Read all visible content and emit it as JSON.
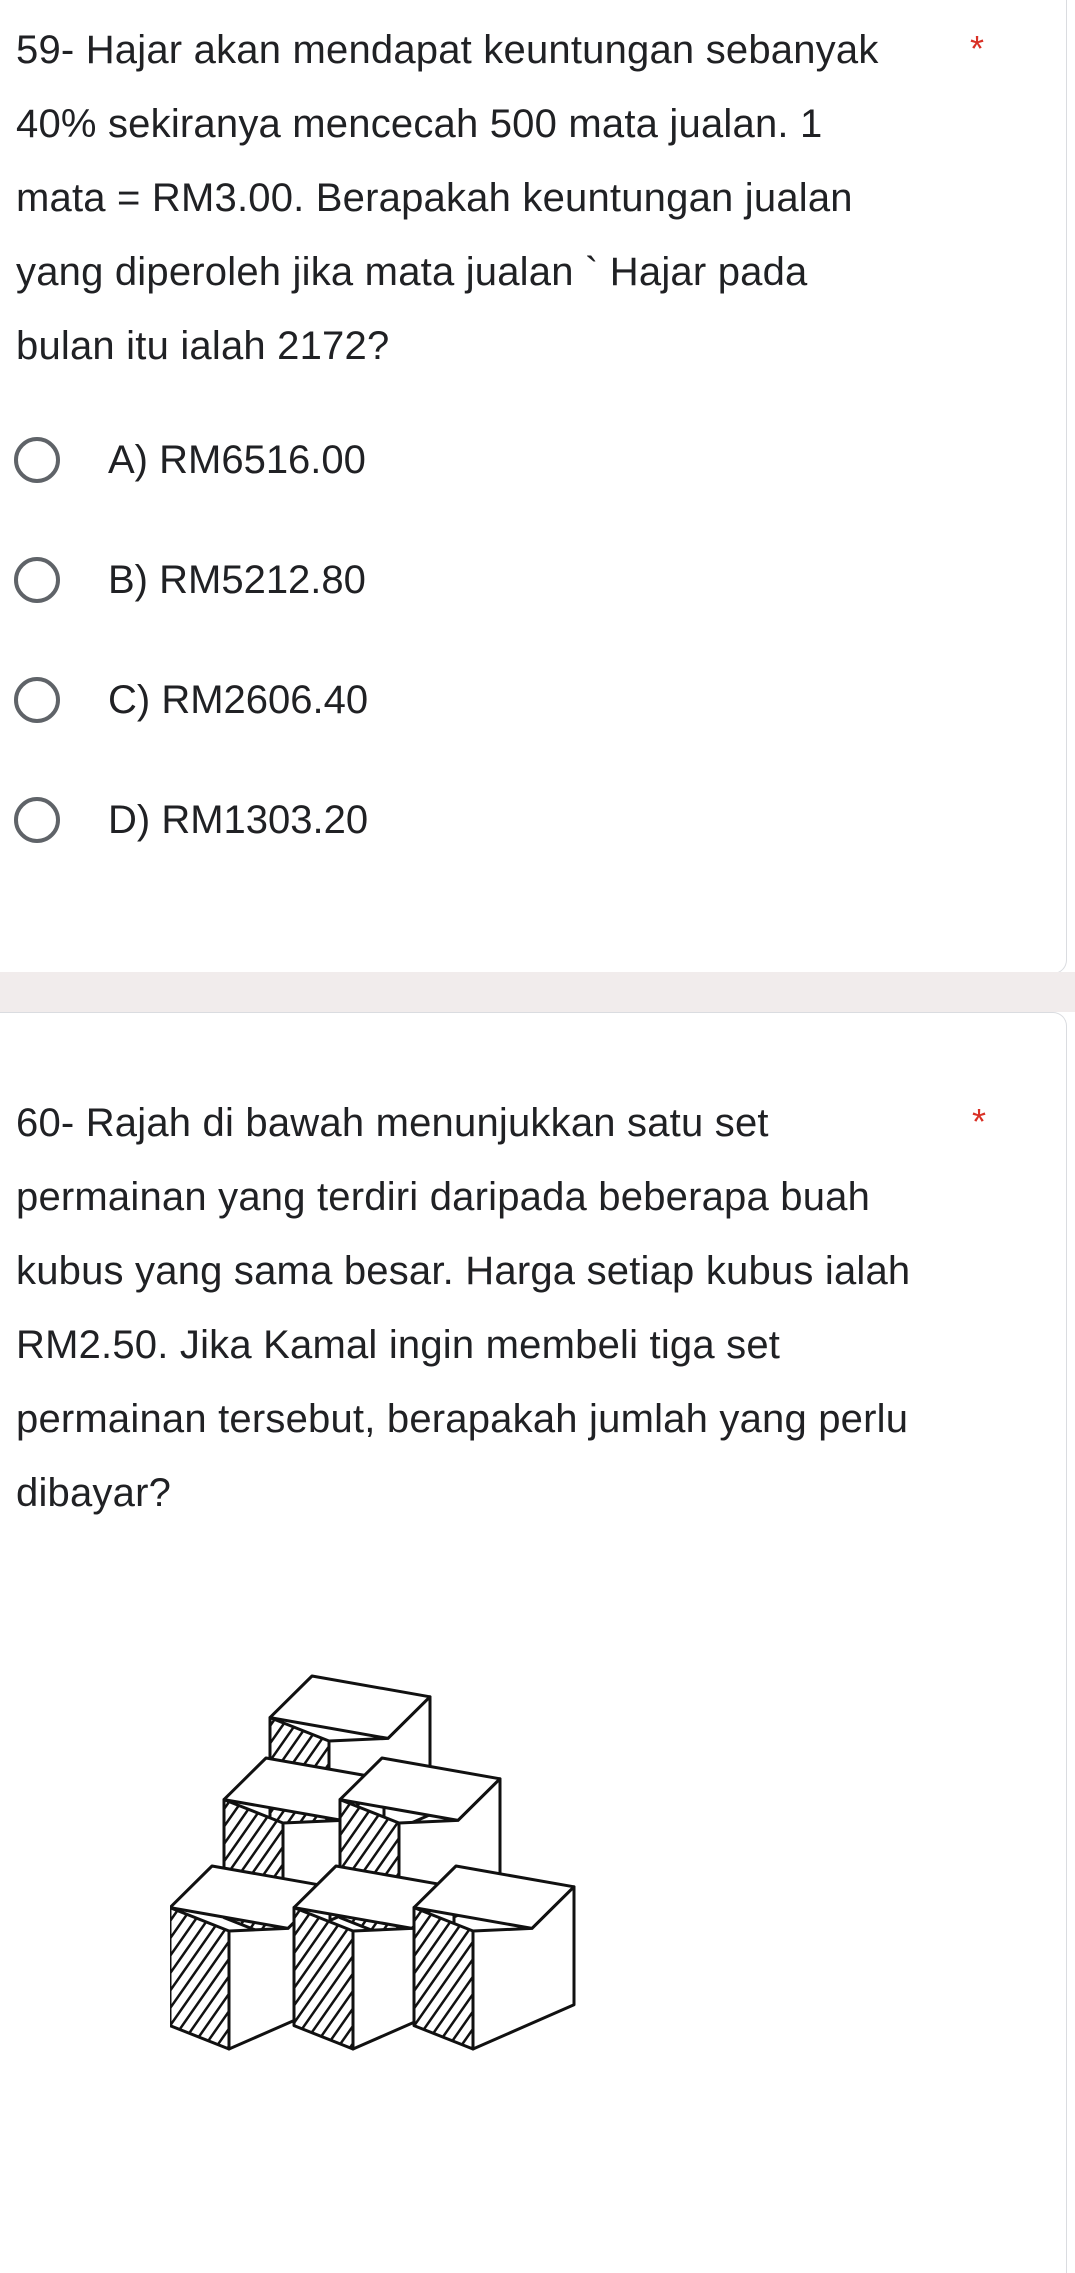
{
  "q59": {
    "text": "59- Hajar akan mendapat keuntungan sebanyak 40% sekiranya mencecah 500 mata jualan. 1 mata = RM3.00. Berapakah keuntungan jualan yang diperoleh jika mata jualan ` Hajar pada bulan itu ialah 2172?",
    "required": "*",
    "options": [
      {
        "label": "A) RM6516.00"
      },
      {
        "label": "B) RM5212.80"
      },
      {
        "label": "C) RM2606.40"
      },
      {
        "label": "D) RM1303.20"
      }
    ]
  },
  "q60": {
    "text": "60- Rajah di bawah menunjukkan satu set permainan yang terdiri daripada beberapa buah kubus yang sama besar. Harga setiap kubus ialah RM2.50. Jika Kamal ingin membeli tiga set permainan tersebut, berapakah jumlah yang perlu dibayar?",
    "required": "*",
    "figure": "cube-stack-diagram"
  }
}
